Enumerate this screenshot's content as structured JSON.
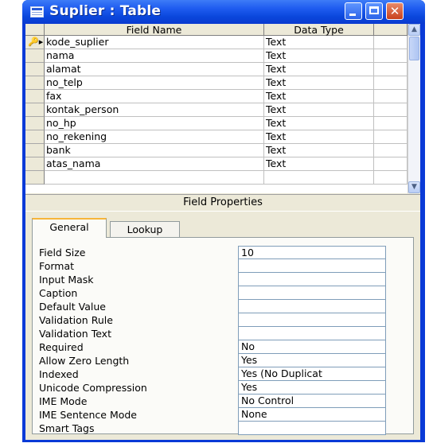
{
  "window": {
    "title": "Suplier : Table",
    "icon": "table-icon",
    "controls": {
      "minimize": "minimize-icon",
      "maximize": "maximize-icon",
      "close": "✕"
    }
  },
  "grid": {
    "columns": {
      "field_name": "Field Name",
      "data_type": "Data Type"
    },
    "rows": [
      {
        "field_name": "kode_suplier",
        "data_type": "Text",
        "primary_key": true
      },
      {
        "field_name": "nama",
        "data_type": "Text"
      },
      {
        "field_name": "alamat",
        "data_type": "Text"
      },
      {
        "field_name": "no_telp",
        "data_type": "Text"
      },
      {
        "field_name": "fax",
        "data_type": "Text"
      },
      {
        "field_name": "kontak_person",
        "data_type": "Text"
      },
      {
        "field_name": "no_hp",
        "data_type": "Text"
      },
      {
        "field_name": "no_rekening",
        "data_type": "Text"
      },
      {
        "field_name": "bank",
        "data_type": "Text"
      },
      {
        "field_name": "atas_nama",
        "data_type": "Text"
      }
    ],
    "row_indicator_glyph": "🔑▸"
  },
  "field_properties_label": "Field Properties",
  "tabs": {
    "general": "General",
    "lookup": "Lookup"
  },
  "properties": [
    {
      "label": "Field Size",
      "value": "10"
    },
    {
      "label": "Format",
      "value": ""
    },
    {
      "label": "Input Mask",
      "value": ""
    },
    {
      "label": "Caption",
      "value": ""
    },
    {
      "label": "Default Value",
      "value": ""
    },
    {
      "label": "Validation Rule",
      "value": ""
    },
    {
      "label": "Validation Text",
      "value": ""
    },
    {
      "label": "Required",
      "value": "No"
    },
    {
      "label": "Allow Zero Length",
      "value": "Yes"
    },
    {
      "label": "Indexed",
      "value": "Yes (No Duplicat"
    },
    {
      "label": "Unicode Compression",
      "value": "Yes"
    },
    {
      "label": "IME Mode",
      "value": "No Control"
    },
    {
      "label": "IME Sentence Mode",
      "value": "None"
    },
    {
      "label": "Smart Tags",
      "value": ""
    }
  ],
  "colors": {
    "titlebar": "#1f5cf0",
    "window_frame": "#0a3ad7",
    "face": "#ece9d8",
    "tab_highlight": "#f6b53a",
    "close_button": "#c8411c"
  }
}
